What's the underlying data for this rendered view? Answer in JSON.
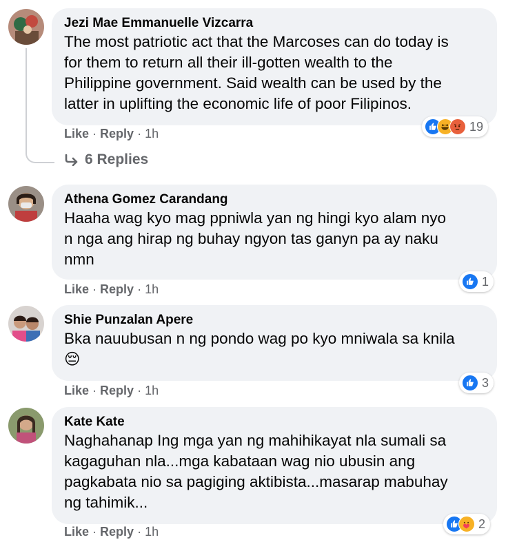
{
  "comments": [
    {
      "author": "Jezi Mae Emmanuelle Vizcarra",
      "lines": [
        "The most patriotic act that the Marcoses can do today is",
        "for them to return all their ill-gotten wealth to the",
        "Philippine government. Said wealth can be used by the",
        "latter in uplifting the economic life of poor Filipinos."
      ],
      "like_label": "Like",
      "reply_label": "Reply",
      "time": "1h",
      "reactions": [
        "like-icon",
        "haha-icon",
        "angry-icon"
      ],
      "reaction_count": "19"
    },
    {
      "author": "Athena Gomez Carandang",
      "lines": [
        "Haaha wag kyo mag ppniwla yan ng hingi kyo alam nyo",
        "n nga ang hirap ng buhay ngyon tas ganyn pa ay naku",
        "nmn"
      ],
      "like_label": "Like",
      "reply_label": "Reply",
      "time": "1h",
      "reactions": [
        "like-icon"
      ],
      "reaction_count": "1"
    },
    {
      "author": "Shie Punzalan Apere",
      "lines": [
        "Bka nauubusan n ng pondo wag po kyo mniwala sa knila"
      ],
      "emoji_line": "😔",
      "like_label": "Like",
      "reply_label": "Reply",
      "time": "1h",
      "reactions": [
        "like-icon"
      ],
      "reaction_count": "3"
    },
    {
      "author": "Kate Kate",
      "lines": [
        "Naghahanap Ing mga yan ng mahihikayat nla sumali sa",
        "kagaguhan nla...mga kabataan wag nio ubusin ang",
        "pagkabata nio sa pagiging aktibista...masarap mabuhay",
        "ng tahimik..."
      ],
      "like_label": "Like",
      "reply_label": "Reply",
      "time": "1h",
      "reactions": [
        "like-icon",
        "care-icon"
      ],
      "reaction_count": "2"
    }
  ],
  "view_replies": "6 Replies",
  "colors": {
    "bubble": "#f0f2f5",
    "meta": "#65676b",
    "like": "#1877f2"
  }
}
